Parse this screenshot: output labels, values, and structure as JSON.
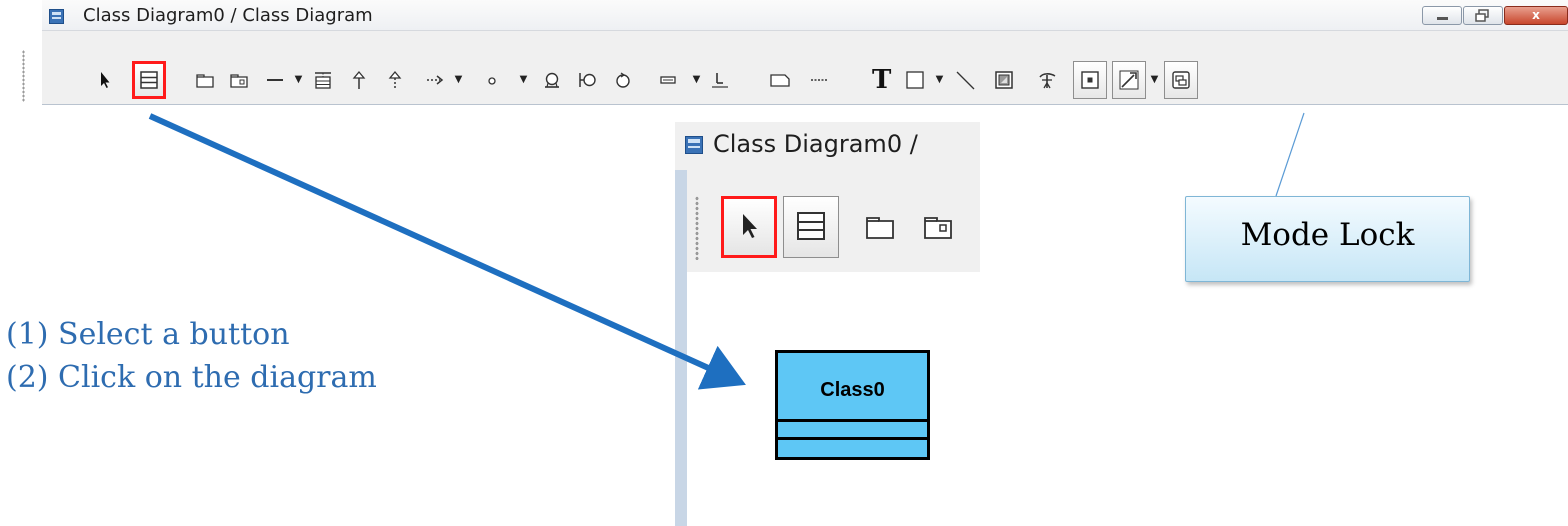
{
  "window": {
    "title": "Class Diagram0 / Class Diagram",
    "controls": {
      "close_label": "x"
    }
  },
  "toolbar": {
    "selected_tool": "class",
    "tools": [
      "select-arrow",
      "class",
      "package",
      "subsystem",
      "association",
      "association-class",
      "generalization",
      "realization",
      "dependency",
      "interface",
      "boundary",
      "control",
      "entity",
      "attribute",
      "constraint",
      "note",
      "note-anchor",
      "text",
      "rectangle",
      "line",
      "image",
      "mode-lock",
      "zoom",
      "connector-style",
      "diagram-frame"
    ],
    "text_tool_label": "T"
  },
  "zoomed_window": {
    "title": "Class Diagram0 /",
    "selected_tool": "select-arrow",
    "tools": [
      "select-arrow",
      "class",
      "package",
      "subsystem"
    ]
  },
  "diagram": {
    "class_name": "Class0",
    "class_fill": "#5ec7f5"
  },
  "annotations": {
    "step1": "(1) Select a button",
    "step2": "(2) Click on the diagram",
    "callout": "Mode Lock",
    "arrow_color": "#1e6fc0",
    "highlight_color": "#ff1a1a",
    "text_color": "#2e6cb0"
  }
}
